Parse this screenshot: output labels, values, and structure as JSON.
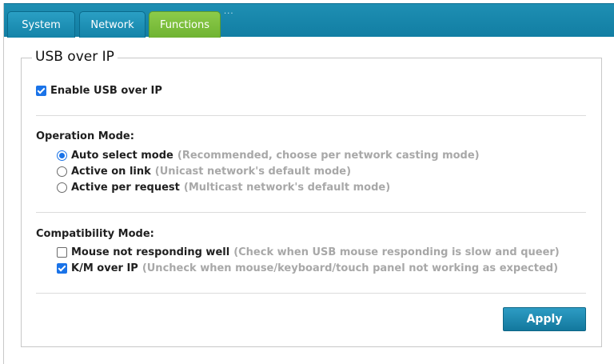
{
  "tabs": [
    {
      "label": "System"
    },
    {
      "label": "Network"
    },
    {
      "label": "Functions"
    }
  ],
  "tab_dots": "...",
  "section": {
    "title": "USB over IP"
  },
  "enable_usb": {
    "label": "Enable USB over IP",
    "checked": true
  },
  "operation_mode": {
    "heading": "Operation Mode:",
    "options": [
      {
        "label": "Auto select mode",
        "hint": "(Recommended, choose per network casting mode)",
        "selected": true
      },
      {
        "label": "Active on link",
        "hint": "(Unicast network's default mode)",
        "selected": false
      },
      {
        "label": "Active per request",
        "hint": "(Multicast network's default mode)",
        "selected": false
      }
    ]
  },
  "compatibility_mode": {
    "heading": "Compatibility Mode:",
    "options": [
      {
        "label": "Mouse not responding well",
        "hint": "(Check when USB mouse responding is slow and queer)",
        "checked": false
      },
      {
        "label": "K/M over IP",
        "hint": "(Uncheck when mouse/keyboard/touch panel not working as expected)",
        "checked": true
      }
    ]
  },
  "apply_label": "Apply",
  "colors": {
    "tabbar": "#1a88ad",
    "active_tab": "#7dbd3e",
    "accent": "#1a73e8",
    "hint_text": "#a8a8a8"
  }
}
